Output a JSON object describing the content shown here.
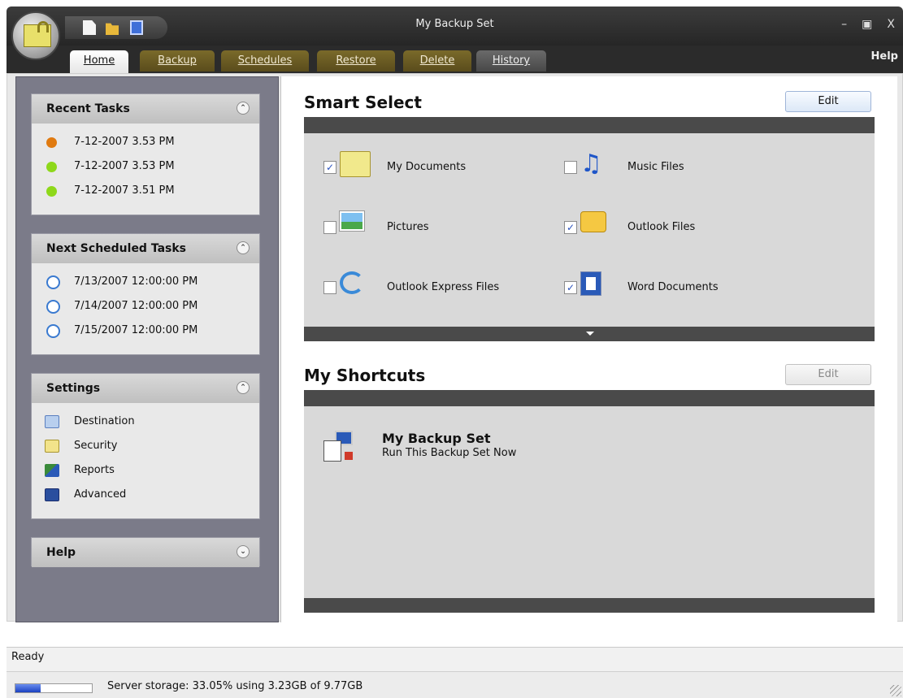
{
  "window": {
    "title": "My Backup Set",
    "help_label": "Help"
  },
  "tabs": [
    {
      "label": "Home",
      "active": true
    },
    {
      "label": "Backup"
    },
    {
      "label": "Schedules"
    },
    {
      "label": "Restore"
    },
    {
      "label": "Delete"
    },
    {
      "label": "History"
    }
  ],
  "sidebar": {
    "recent": {
      "title": "Recent Tasks",
      "items": [
        {
          "label": "7-12-2007 3.53 PM",
          "color": "#e07a10"
        },
        {
          "label": "7-12-2007 3.53 PM",
          "color": "#8ed81a"
        },
        {
          "label": "7-12-2007 3.51 PM",
          "color": "#8ed81a"
        }
      ]
    },
    "scheduled": {
      "title": "Next Scheduled Tasks",
      "items": [
        {
          "label": "7/13/2007 12:00:00 PM"
        },
        {
          "label": "7/14/2007 12:00:00 PM"
        },
        {
          "label": "7/15/2007 12:00:00 PM"
        }
      ]
    },
    "settings": {
      "title": "Settings",
      "items": [
        {
          "label": "Destination",
          "icon": "destination-icon"
        },
        {
          "label": "Security",
          "icon": "folder-icon"
        },
        {
          "label": "Reports",
          "icon": "reports-icon"
        },
        {
          "label": "Advanced",
          "icon": "advanced-icon"
        }
      ]
    },
    "help": {
      "title": "Help"
    }
  },
  "smart_select": {
    "title": "Smart Select",
    "edit_label": "Edit",
    "items": [
      {
        "label": "My Documents",
        "checked": true,
        "icon": "folder-icon"
      },
      {
        "label": "Music Files",
        "checked": false,
        "icon": "music-icon"
      },
      {
        "label": "Pictures",
        "checked": false,
        "icon": "picture-icon"
      },
      {
        "label": "Outlook Files",
        "checked": true,
        "icon": "outlook-icon"
      },
      {
        "label": "Outlook Express Files",
        "checked": false,
        "icon": "outlook-express-icon"
      },
      {
        "label": "Word Documents",
        "checked": true,
        "icon": "word-icon"
      }
    ]
  },
  "shortcuts": {
    "title": "My Shortcuts",
    "edit_label": "Edit",
    "item": {
      "title": "My Backup Set",
      "subtitle": "Run This Backup Set Now"
    }
  },
  "status": {
    "text": "Ready",
    "storage_text": "Server storage: 33.05% using 3.23GB of 9.77GB",
    "storage_fraction": 0.3305
  }
}
